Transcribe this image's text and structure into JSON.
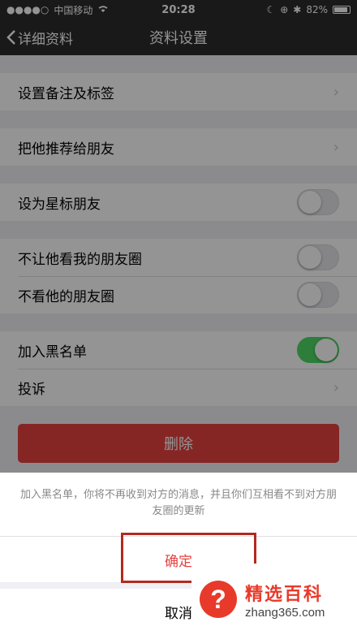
{
  "status_bar": {
    "carrier": "中国移动",
    "time": "20:28",
    "battery": "82%"
  },
  "nav": {
    "back_label": "详细资料",
    "title": "资料设置"
  },
  "settings": {
    "remark_tags": "设置备注及标签",
    "recommend": "把他推荐给朋友",
    "star_friend": "设为星标朋友",
    "star_friend_on": false,
    "hide_my_moments": "不让他看我的朋友圈",
    "hide_my_moments_on": false,
    "hide_his_moments": "不看他的朋友圈",
    "hide_his_moments_on": false,
    "blacklist": "加入黑名单",
    "blacklist_on": true,
    "complain": "投诉",
    "delete_label": "删除"
  },
  "action_sheet": {
    "message": "加入黑名单，你将不再收到对方的消息，并且你们互相看不到对方朋友圈的更新",
    "confirm_label": "确定",
    "cancel_label": "取消"
  },
  "watermark": {
    "title": "精选百科",
    "url": "zhang365.com"
  },
  "colors": {
    "accent_red": "#e64340",
    "toggle_green": "#4cd964"
  }
}
